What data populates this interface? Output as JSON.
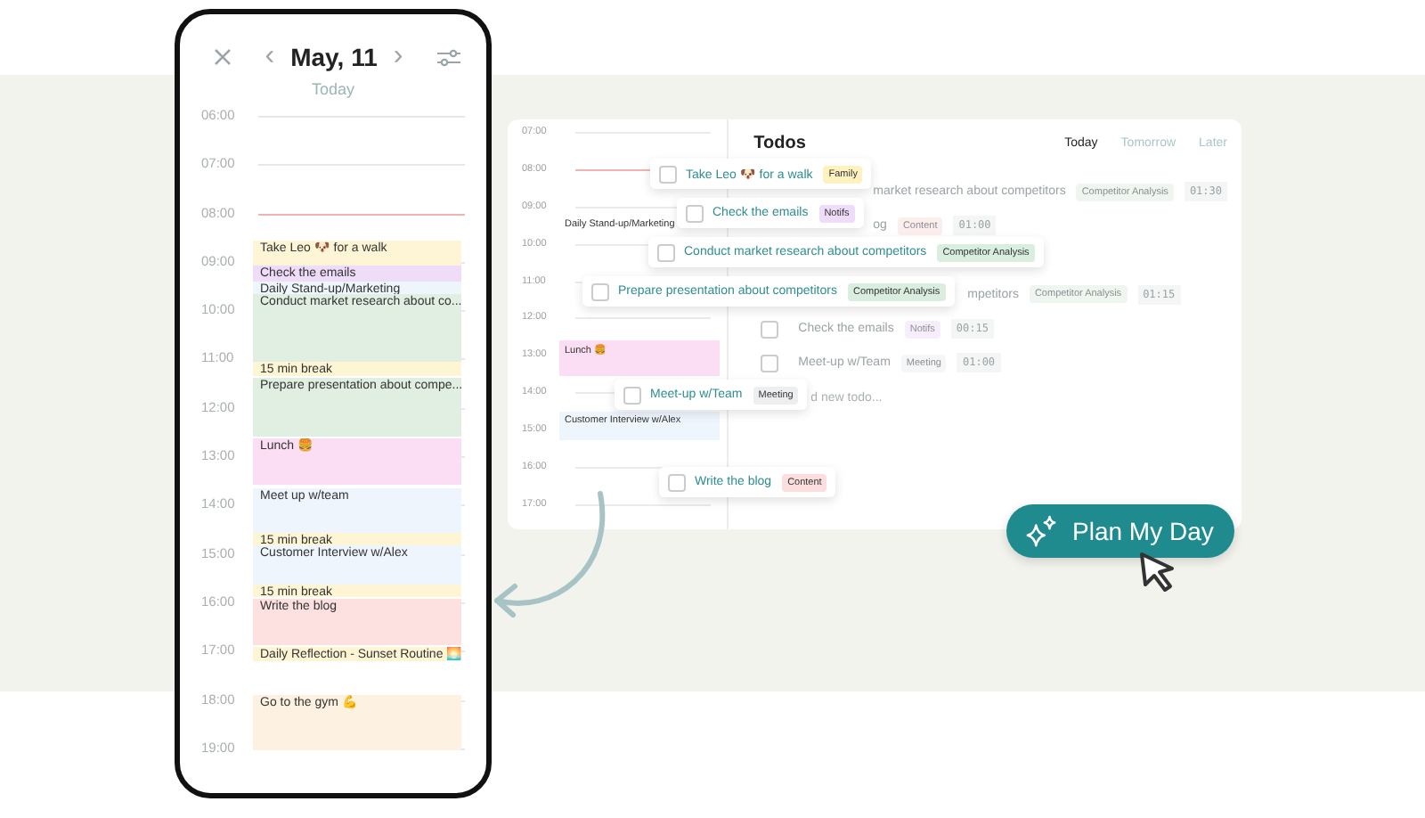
{
  "phone": {
    "date": "May, 11",
    "prev": "‹",
    "next": "›",
    "subtitle": "Today",
    "hours": [
      {
        "label": "06:00",
        "current": false
      },
      {
        "label": "07:00",
        "current": false
      },
      {
        "label": "08:00",
        "current": true
      },
      {
        "label": "09:00",
        "current": false
      },
      {
        "label": "10:00",
        "current": false
      },
      {
        "label": "11:00",
        "current": false
      },
      {
        "label": "12:00",
        "current": false
      },
      {
        "label": "13:00",
        "current": false
      },
      {
        "label": "14:00",
        "current": false
      },
      {
        "label": "15:00",
        "current": false
      },
      {
        "label": "16:00",
        "current": false
      },
      {
        "label": "17:00",
        "current": false
      },
      {
        "label": "18:00",
        "current": false
      },
      {
        "label": "19:00",
        "current": false
      }
    ],
    "events": [
      {
        "title": "Take Leo 🐶 for a walk",
        "color": "#fdf5d6"
      },
      {
        "title": "Check the emails",
        "color": "#eedcf8"
      },
      {
        "title": "Daily Stand-up/Marketing",
        "color": "#eef5fb"
      },
      {
        "title": "Conduct market research about co...",
        "color": "#e1efe3"
      },
      {
        "title": "15 min break",
        "color": "#fdf5d3"
      },
      {
        "title": "Prepare presentation about compe...",
        "color": "#e1efe3"
      },
      {
        "title": "Lunch 🍔",
        "color": "#fbddf4"
      },
      {
        "title": "Meet up w/team",
        "color": "#eef5fc"
      },
      {
        "title": "15 min break",
        "color": "#fdf5d3"
      },
      {
        "title": "Customer Interview w/Alex",
        "color": "#eef5fc"
      },
      {
        "title": "15 min break",
        "color": "#fdf5d3"
      },
      {
        "title": "Write the blog",
        "color": "#fde1e1"
      },
      {
        "title": "Daily Reflection - Sunset Routine 🌅",
        "color": "#fdf5d3"
      },
      {
        "title": "Go to the gym 💪",
        "color": "#fdf2e1"
      }
    ]
  },
  "planner": {
    "hours": [
      {
        "label": "07:00",
        "current": false
      },
      {
        "label": "08:00",
        "current": true
      },
      {
        "label": "09:00",
        "current": false
      },
      {
        "label": "10:00",
        "current": false
      },
      {
        "label": "11:00",
        "current": false
      },
      {
        "label": "12:00",
        "current": false
      },
      {
        "label": "13:00",
        "current": false
      },
      {
        "label": "14:00",
        "current": false
      },
      {
        "label": "15:00",
        "current": false
      },
      {
        "label": "16:00",
        "current": false
      },
      {
        "label": "17:00",
        "current": false
      }
    ],
    "events": [
      {
        "title": "Daily Stand-up/Marketing",
        "color": "#ffffff"
      },
      {
        "title": "Lunch 🍔",
        "color": "#fbddf4"
      },
      {
        "title": "Customer Interview w/Alex",
        "color": "#eef5fc"
      }
    ],
    "todos_title": "Todos",
    "tabs": [
      {
        "label": "Today",
        "selected": true
      },
      {
        "label": "Tomorrow",
        "selected": false
      },
      {
        "label": "Later",
        "selected": false
      }
    ],
    "rows": [
      {
        "kind": "todo",
        "text": "market research about competitors",
        "tag": {
          "label": "Competitor Analysis",
          "color": "#e3f1e6"
        },
        "duration": "01:30"
      },
      {
        "kind": "todo",
        "text": "og",
        "tag": {
          "label": "Content",
          "color": "#fde4e4"
        },
        "duration": "01:00"
      },
      {
        "kind": "todo",
        "text": "mpetitors",
        "tag": {
          "label": "Competitor Analysis",
          "color": "#e3f1e6"
        },
        "duration": "01:15"
      },
      {
        "kind": "todo",
        "checked": false,
        "text": "Check the emails",
        "tag": {
          "label": "Notifs",
          "color": "#f2e4fb"
        },
        "duration": "00:15"
      },
      {
        "kind": "todo",
        "checked": false,
        "text": "Meet-up w/Team",
        "tag": {
          "label": "Meeting",
          "color": "#eff1f3"
        },
        "duration": "01:00"
      },
      {
        "kind": "add",
        "text": "d new todo..."
      }
    ]
  },
  "dragged": [
    {
      "checked": false,
      "text": "Take Leo 🐶 for a walk",
      "tag": {
        "label": "Family",
        "color": "#fdf2c0"
      }
    },
    {
      "checked": false,
      "text": "Check the emails",
      "tag": {
        "label": "Notifs",
        "color": "#efdcfb"
      }
    },
    {
      "checked": false,
      "text": "Conduct market research about competitors",
      "tag": {
        "label": "Competitor Analysis",
        "color": "#d9eedf"
      }
    },
    {
      "checked": false,
      "text": "Prepare presentation about competitors",
      "tag": {
        "label": "Competitor Analysis",
        "color": "#d9eedf"
      }
    },
    {
      "checked": false,
      "text": "Meet-up w/Team",
      "tag": {
        "label": "Meeting",
        "color": "#eceef0"
      }
    },
    {
      "checked": false,
      "text": "Write the blog",
      "tag": {
        "label": "Content",
        "color": "#fddede"
      }
    }
  ],
  "cta": {
    "label": "Plan My Day"
  }
}
